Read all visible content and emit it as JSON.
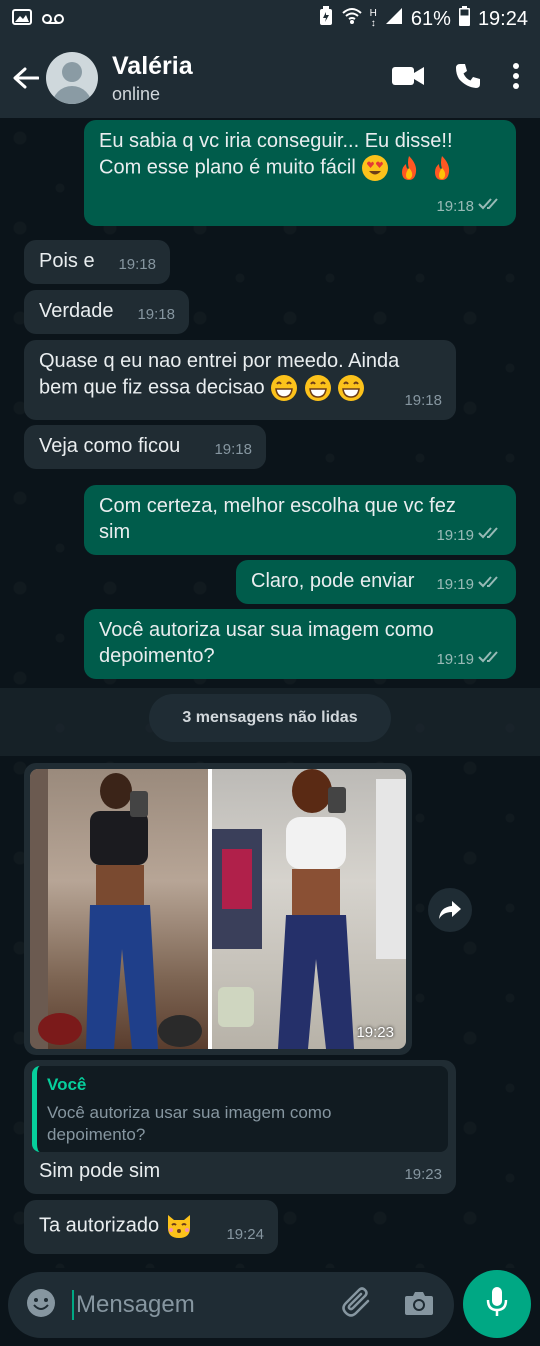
{
  "status_bar": {
    "battery_percent": "61%",
    "time": "19:24",
    "network": "H"
  },
  "header": {
    "contact_name": "Valéria",
    "contact_status": "online"
  },
  "messages": [
    {
      "direction": "out",
      "lines": [
        "Eu sabia q vc iria conseguir... Eu disse!!",
        "Com esse plano é muito fácil"
      ],
      "time": "19:18",
      "status": "read"
    },
    {
      "direction": "in",
      "text": "Pois e",
      "time": "19:18"
    },
    {
      "direction": "in",
      "text": "Verdade",
      "time": "19:18"
    },
    {
      "direction": "in",
      "lines": [
        "Quase q eu nao entrei por meedo. Ainda",
        "bem que fiz essa decisao"
      ],
      "time": "19:18"
    },
    {
      "direction": "in",
      "text": "Veja como ficou",
      "time": "19:18"
    },
    {
      "direction": "out",
      "lines": [
        "Com certeza, melhor escolha que vc fez",
        "sim"
      ],
      "time": "19:19",
      "status": "read"
    },
    {
      "direction": "out",
      "text": "Claro, pode enviar",
      "time": "19:19",
      "status": "read"
    },
    {
      "direction": "out",
      "lines": [
        "Você autoriza usar sua imagem como",
        "depoimento?"
      ],
      "time": "19:19",
      "status": "read"
    }
  ],
  "unread_divider": "3 mensagens não lidas",
  "photo_message": {
    "time": "19:23"
  },
  "reply_message": {
    "quote_author": "Você",
    "quote_lines": [
      "Você autoriza usar sua imagem como",
      "depoimento?"
    ],
    "text": "Sim pode sim",
    "time": "19:23"
  },
  "last_message": {
    "text": "Ta autorizado",
    "time": "19:24"
  },
  "input": {
    "placeholder": "Mensagem"
  },
  "colors": {
    "outgoing_bubble": "#005c4b",
    "incoming_bubble": "#202c33",
    "accent": "#00a884",
    "quote_accent": "#06cf9c"
  }
}
